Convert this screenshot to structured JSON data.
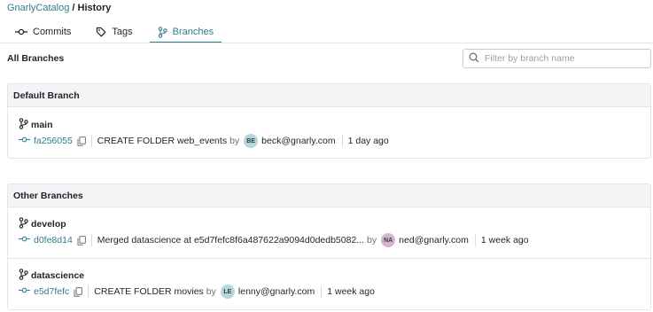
{
  "breadcrumb": {
    "repo": "GnarlyCatalog",
    "separator": "/",
    "page": "History"
  },
  "tabs": [
    {
      "label": "Commits",
      "icon": "commit-icon",
      "active": false
    },
    {
      "label": "Tags",
      "icon": "tag-icon",
      "active": false
    },
    {
      "label": "Branches",
      "icon": "branch-icon",
      "active": true
    }
  ],
  "section_title": "All Branches",
  "filter": {
    "placeholder": "Filter by branch name",
    "value": ""
  },
  "default_panel": {
    "title": "Default Branch",
    "branches": [
      {
        "name": "main",
        "sha": "fa256055",
        "message": "CREATE FOLDER web_events",
        "by": "by",
        "avatar_initials": "BE",
        "avatar_color": "#b4d7dc",
        "email": "beck@gnarly.com",
        "date": "1 day ago"
      }
    ]
  },
  "other_panel": {
    "title": "Other Branches",
    "branches": [
      {
        "name": "develop",
        "sha": "d0fe8d14",
        "message": "Merged datascience at e5d7fefc8f6a487622a9094d0dedb5082...",
        "by": "by",
        "avatar_initials": "NA",
        "avatar_color": "#d8b4c8",
        "email": "ned@gnarly.com",
        "date": "1 week ago"
      },
      {
        "name": "datascience",
        "sha": "e5d7fefc",
        "message": "CREATE FOLDER movies",
        "by": "by",
        "avatar_initials": "LE",
        "avatar_color": "#b4d7dc",
        "email": "lenny@gnarly.com",
        "date": "1 week ago"
      }
    ]
  },
  "colors": {
    "accent": "#2f7d8c",
    "panel_header": "#f3f4f5",
    "border": "#e3e5e8"
  }
}
